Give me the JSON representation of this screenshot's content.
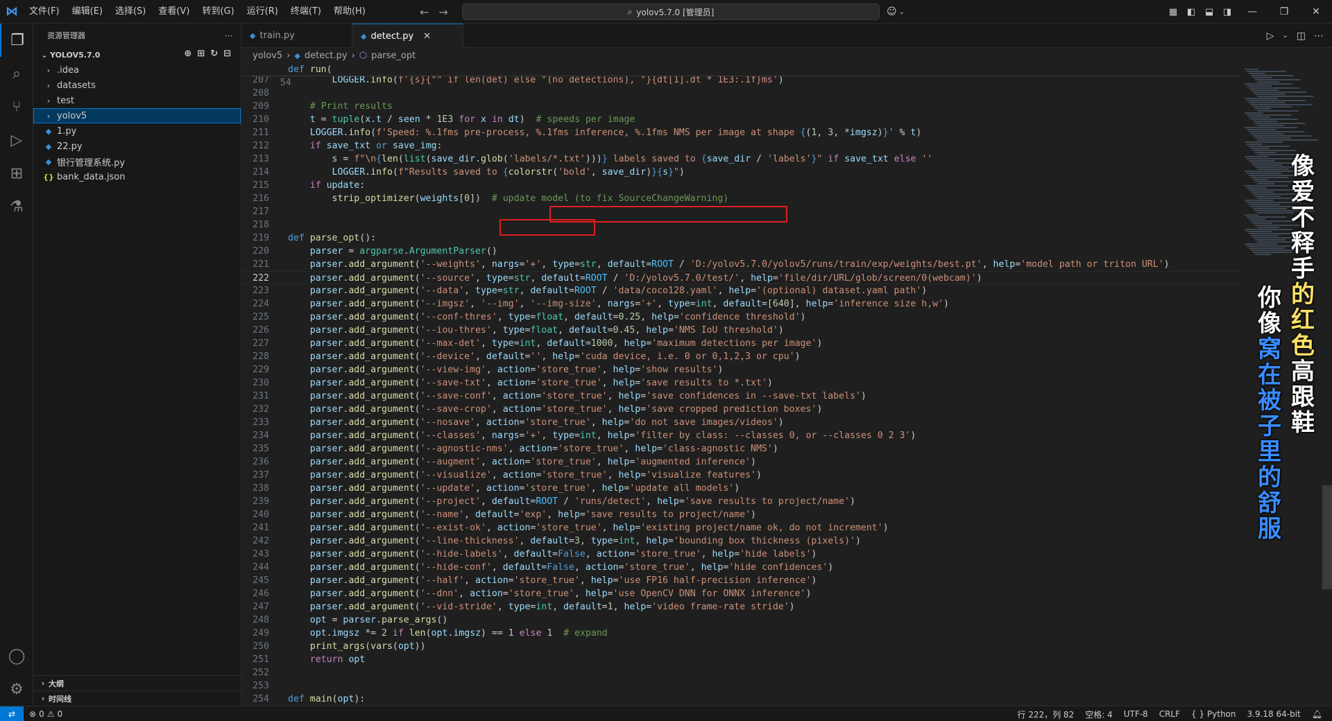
{
  "menu": [
    "文件(F)",
    "编辑(E)",
    "选择(S)",
    "查看(V)",
    "转到(G)",
    "运行(R)",
    "终端(T)",
    "帮助(H)"
  ],
  "command_center": "yolov5.7.0 [管理员]",
  "sidebar": {
    "title": "资源管理器",
    "root": "YOLOV5.7.0",
    "items": [
      {
        "label": ".idea",
        "type": "folder"
      },
      {
        "label": "datasets",
        "type": "folder"
      },
      {
        "label": "test",
        "type": "folder"
      },
      {
        "label": "yolov5",
        "type": "folder",
        "selected": true
      },
      {
        "label": "1.py",
        "type": "py"
      },
      {
        "label": "22.py",
        "type": "py"
      },
      {
        "label": "银行管理系统.py",
        "type": "py"
      },
      {
        "label": "bank_data.json",
        "type": "json"
      }
    ],
    "outline": "大纲",
    "timeline": "时间线"
  },
  "tabs": [
    {
      "label": "train.py",
      "active": false
    },
    {
      "label": "detect.py",
      "active": true
    }
  ],
  "breadcrumb": [
    "yolov5",
    "detect.py",
    "parse_opt"
  ],
  "sticky": {
    "ln": "54",
    "text": "def run("
  },
  "lines": [
    {
      "ln": "207",
      "html": "        <span class='var'>LOGGER</span>.<span class='fn'>info</span>(<span class='str'>f'{s}{\"\" if len(det) else \"(no detections), \"}{dt[1].dt * 1E3:.1f}ms'</span>)"
    },
    {
      "ln": "208",
      "html": ""
    },
    {
      "ln": "209",
      "html": "    <span class='cmt'># Print results</span>"
    },
    {
      "ln": "210",
      "html": "    <span class='var'>t</span> = <span class='cls'>tuple</span>(<span class='var'>x</span>.<span class='var'>t</span> / <span class='var'>seen</span> * <span class='num'>1E3</span> <span class='kc'>for</span> <span class='var'>x</span> <span class='kc'>in</span> <span class='var'>dt</span>)  <span class='cmt'># speeds per image</span>"
    },
    {
      "ln": "211",
      "html": "    <span class='var'>LOGGER</span>.<span class='fn'>info</span>(<span class='str'>f'Speed: %.1fms pre-process, %.1fms inference, %.1fms NMS per image at shape </span><span class='kw'>{</span>(<span class='num'>1</span>, <span class='num'>3</span>, *<span class='var'>imgsz</span>)<span class='kw'>}</span><span class='str'>'</span> % <span class='var'>t</span>)"
    },
    {
      "ln": "212",
      "html": "    <span class='kc'>if</span> <span class='var'>save_txt</span> <span class='kw'>or</span> <span class='var'>save_img</span>:"
    },
    {
      "ln": "213",
      "html": "        <span class='var'>s</span> = <span class='str'>f\"\\n</span><span class='kw'>{</span><span class='fn'>len</span>(<span class='cls'>list</span>(<span class='var'>save_dir</span>.<span class='fn'>glob</span>(<span class='str'>'labels/*.txt'</span>)))<span class='kw'>}</span><span class='str'> labels saved to </span><span class='kw'>{</span><span class='var'>save_dir</span> / <span class='str'>'labels'</span><span class='kw'>}</span><span class='str'>\"</span> <span class='kc'>if</span> <span class='var'>save_txt</span> <span class='kc'>else</span> <span class='str'>''</span>"
    },
    {
      "ln": "214",
      "html": "        <span class='var'>LOGGER</span>.<span class='fn'>info</span>(<span class='str'>f\"Results saved to </span><span class='kw'>{</span><span class='fn'>colorstr</span>(<span class='str'>'bold'</span>, <span class='var'>save_dir</span>)<span class='kw'>}</span><span class='kw'>{</span><span class='var'>s</span><span class='kw'>}</span><span class='str'>\"</span>)"
    },
    {
      "ln": "215",
      "html": "    <span class='kc'>if</span> <span class='var'>update</span>:"
    },
    {
      "ln": "216",
      "html": "        <span class='fn'>strip_optimizer</span>(<span class='var'>weights</span>[<span class='num'>0</span>])  <span class='cmt'># update model (to fix SourceChangeWarning)</span>"
    },
    {
      "ln": "217",
      "html": ""
    },
    {
      "ln": "218",
      "html": ""
    },
    {
      "ln": "219",
      "html": "<span class='kw'>def</span> <span class='fn'>parse_opt</span>():"
    },
    {
      "ln": "220",
      "html": "    <span class='var'>parser</span> = <span class='cls'>argparse</span>.<span class='cls'>ArgumentParser</span>()"
    },
    {
      "ln": "221",
      "html": "    <span class='var'>parser</span>.<span class='fn'>add_argument</span>(<span class='str'>'--weights'</span>, <span class='var'>nargs</span>=<span class='str'>'+'</span>, <span class='var'>type</span>=<span class='cls'>str</span>, <span class='var'>default</span>=<span class='const'>ROOT</span> / <span class='str'>'D:/yolov5.7.0/yolov5/runs/train/exp/weights/best.pt'</span>, <span class='var'>help</span>=<span class='str'>'model path or triton URL'</span>)"
    },
    {
      "ln": "222",
      "cur": true,
      "html": "    <span class='var'>parser</span>.<span class='fn'>add_argument</span>(<span class='str'>'--source'</span>, <span class='var'>type</span>=<span class='cls'>str</span>, <span class='var'>default</span>=<span class='const'>ROOT</span> / <span class='str'>'D:/yolov5.7.0/test/'</span>, <span class='var'>help</span>=<span class='str'>'file/dir/URL/glob/screen/0(webcam)'</span>)"
    },
    {
      "ln": "223",
      "html": "    <span class='var'>parser</span>.<span class='fn'>add_argument</span>(<span class='str'>'--data'</span>, <span class='var'>type</span>=<span class='cls'>str</span>, <span class='var'>default</span>=<span class='const'>ROOT</span> / <span class='str'>'data/coco128.yaml'</span>, <span class='var'>help</span>=<span class='str'>'(optional) dataset.yaml path'</span>)"
    },
    {
      "ln": "224",
      "html": "    <span class='var'>parser</span>.<span class='fn'>add_argument</span>(<span class='str'>'--imgsz'</span>, <span class='str'>'--img'</span>, <span class='str'>'--img-size'</span>, <span class='var'>nargs</span>=<span class='str'>'+'</span>, <span class='var'>type</span>=<span class='cls'>int</span>, <span class='var'>default</span>=[<span class='num'>640</span>], <span class='var'>help</span>=<span class='str'>'inference size h,w'</span>)"
    },
    {
      "ln": "225",
      "html": "    <span class='var'>parser</span>.<span class='fn'>add_argument</span>(<span class='str'>'--conf-thres'</span>, <span class='var'>type</span>=<span class='cls'>float</span>, <span class='var'>default</span>=<span class='num'>0.25</span>, <span class='var'>help</span>=<span class='str'>'confidence threshold'</span>)"
    },
    {
      "ln": "226",
      "html": "    <span class='var'>parser</span>.<span class='fn'>add_argument</span>(<span class='str'>'--iou-thres'</span>, <span class='var'>type</span>=<span class='cls'>float</span>, <span class='var'>default</span>=<span class='num'>0.45</span>, <span class='var'>help</span>=<span class='str'>'NMS IoU threshold'</span>)"
    },
    {
      "ln": "227",
      "html": "    <span class='var'>parser</span>.<span class='fn'>add_argument</span>(<span class='str'>'--max-det'</span>, <span class='var'>type</span>=<span class='cls'>int</span>, <span class='var'>default</span>=<span class='num'>1000</span>, <span class='var'>help</span>=<span class='str'>'maximum detections per image'</span>)"
    },
    {
      "ln": "228",
      "html": "    <span class='var'>parser</span>.<span class='fn'>add_argument</span>(<span class='str'>'--device'</span>, <span class='var'>default</span>=<span class='str'>''</span>, <span class='var'>help</span>=<span class='str'>'cuda device, i.e. 0 or 0,1,2,3 or cpu'</span>)"
    },
    {
      "ln": "229",
      "html": "    <span class='var'>parser</span>.<span class='fn'>add_argument</span>(<span class='str'>'--view-img'</span>, <span class='var'>action</span>=<span class='str'>'store_true'</span>, <span class='var'>help</span>=<span class='str'>'show results'</span>)"
    },
    {
      "ln": "230",
      "html": "    <span class='var'>parser</span>.<span class='fn'>add_argument</span>(<span class='str'>'--save-txt'</span>, <span class='var'>action</span>=<span class='str'>'store_true'</span>, <span class='var'>help</span>=<span class='str'>'save results to *.txt'</span>)"
    },
    {
      "ln": "231",
      "html": "    <span class='var'>parser</span>.<span class='fn'>add_argument</span>(<span class='str'>'--save-conf'</span>, <span class='var'>action</span>=<span class='str'>'store_true'</span>, <span class='var'>help</span>=<span class='str'>'save confidences in --save-txt labels'</span>)"
    },
    {
      "ln": "232",
      "html": "    <span class='var'>parser</span>.<span class='fn'>add_argument</span>(<span class='str'>'--save-crop'</span>, <span class='var'>action</span>=<span class='str'>'store_true'</span>, <span class='var'>help</span>=<span class='str'>'save cropped prediction boxes'</span>)"
    },
    {
      "ln": "233",
      "html": "    <span class='var'>parser</span>.<span class='fn'>add_argument</span>(<span class='str'>'--nosave'</span>, <span class='var'>action</span>=<span class='str'>'store_true'</span>, <span class='var'>help</span>=<span class='str'>'do not save images/videos'</span>)"
    },
    {
      "ln": "234",
      "html": "    <span class='var'>parser</span>.<span class='fn'>add_argument</span>(<span class='str'>'--classes'</span>, <span class='var'>nargs</span>=<span class='str'>'+'</span>, <span class='var'>type</span>=<span class='cls'>int</span>, <span class='var'>help</span>=<span class='str'>'filter by class: --classes 0, or --classes 0 2 3'</span>)"
    },
    {
      "ln": "235",
      "html": "    <span class='var'>parser</span>.<span class='fn'>add_argument</span>(<span class='str'>'--agnostic-nms'</span>, <span class='var'>action</span>=<span class='str'>'store_true'</span>, <span class='var'>help</span>=<span class='str'>'class-agnostic NMS'</span>)"
    },
    {
      "ln": "236",
      "html": "    <span class='var'>parser</span>.<span class='fn'>add_argument</span>(<span class='str'>'--augment'</span>, <span class='var'>action</span>=<span class='str'>'store_true'</span>, <span class='var'>help</span>=<span class='str'>'augmented inference'</span>)"
    },
    {
      "ln": "237",
      "html": "    <span class='var'>parser</span>.<span class='fn'>add_argument</span>(<span class='str'>'--visualize'</span>, <span class='var'>action</span>=<span class='str'>'store_true'</span>, <span class='var'>help</span>=<span class='str'>'visualize features'</span>)"
    },
    {
      "ln": "238",
      "html": "    <span class='var'>parser</span>.<span class='fn'>add_argument</span>(<span class='str'>'--update'</span>, <span class='var'>action</span>=<span class='str'>'store_true'</span>, <span class='var'>help</span>=<span class='str'>'update all models'</span>)"
    },
    {
      "ln": "239",
      "html": "    <span class='var'>parser</span>.<span class='fn'>add_argument</span>(<span class='str'>'--project'</span>, <span class='var'>default</span>=<span class='const'>ROOT</span> / <span class='str'>'runs/detect'</span>, <span class='var'>help</span>=<span class='str'>'save results to project/name'</span>)"
    },
    {
      "ln": "240",
      "html": "    <span class='var'>parser</span>.<span class='fn'>add_argument</span>(<span class='str'>'--name'</span>, <span class='var'>default</span>=<span class='str'>'exp'</span>, <span class='var'>help</span>=<span class='str'>'save results to project/name'</span>)"
    },
    {
      "ln": "241",
      "html": "    <span class='var'>parser</span>.<span class='fn'>add_argument</span>(<span class='str'>'--exist-ok'</span>, <span class='var'>action</span>=<span class='str'>'store_true'</span>, <span class='var'>help</span>=<span class='str'>'existing project/name ok, do not increment'</span>)"
    },
    {
      "ln": "242",
      "html": "    <span class='var'>parser</span>.<span class='fn'>add_argument</span>(<span class='str'>'--line-thickness'</span>, <span class='var'>default</span>=<span class='num'>3</span>, <span class='var'>type</span>=<span class='cls'>int</span>, <span class='var'>help</span>=<span class='str'>'bounding box thickness (pixels)'</span>)"
    },
    {
      "ln": "243",
      "html": "    <span class='var'>parser</span>.<span class='fn'>add_argument</span>(<span class='str'>'--hide-labels'</span>, <span class='var'>default</span>=<span class='kw'>False</span>, <span class='var'>action</span>=<span class='str'>'store_true'</span>, <span class='var'>help</span>=<span class='str'>'hide labels'</span>)"
    },
    {
      "ln": "244",
      "html": "    <span class='var'>parser</span>.<span class='fn'>add_argument</span>(<span class='str'>'--hide-conf'</span>, <span class='var'>default</span>=<span class='kw'>False</span>, <span class='var'>action</span>=<span class='str'>'store_true'</span>, <span class='var'>help</span>=<span class='str'>'hide confidences'</span>)"
    },
    {
      "ln": "245",
      "html": "    <span class='var'>parser</span>.<span class='fn'>add_argument</span>(<span class='str'>'--half'</span>, <span class='var'>action</span>=<span class='str'>'store_true'</span>, <span class='var'>help</span>=<span class='str'>'use FP16 half-precision inference'</span>)"
    },
    {
      "ln": "246",
      "html": "    <span class='var'>parser</span>.<span class='fn'>add_argument</span>(<span class='str'>'--dnn'</span>, <span class='var'>action</span>=<span class='str'>'store_true'</span>, <span class='var'>help</span>=<span class='str'>'use OpenCV DNN for ONNX inference'</span>)"
    },
    {
      "ln": "247",
      "html": "    <span class='var'>parser</span>.<span class='fn'>add_argument</span>(<span class='str'>'--vid-stride'</span>, <span class='var'>type</span>=<span class='cls'>int</span>, <span class='var'>default</span>=<span class='num'>1</span>, <span class='var'>help</span>=<span class='str'>'video frame-rate stride'</span>)"
    },
    {
      "ln": "248",
      "html": "    <span class='var'>opt</span> = <span class='var'>parser</span>.<span class='fn'>parse_args</span>()"
    },
    {
      "ln": "249",
      "html": "    <span class='var'>opt</span>.<span class='var'>imgsz</span> *= <span class='num'>2</span> <span class='kc'>if</span> <span class='fn'>len</span>(<span class='var'>opt</span>.<span class='var'>imgsz</span>) == <span class='num'>1</span> <span class='kc'>else</span> <span class='num'>1</span>  <span class='cmt'># expand</span>"
    },
    {
      "ln": "250",
      "html": "    <span class='fn'>print_args</span>(<span class='fn'>vars</span>(<span class='var'>opt</span>))"
    },
    {
      "ln": "251",
      "html": "    <span class='kc'>return</span> <span class='var'>opt</span>"
    },
    {
      "ln": "252",
      "html": ""
    },
    {
      "ln": "253",
      "html": ""
    },
    {
      "ln": "254",
      "html": "<span class='kw'>def</span> <span class='fn'>main</span>(<span class='var'>opt</span>):"
    }
  ],
  "overlay_caption": {
    "right_column": "像爱不释手的红色高跟鞋",
    "left_column": "你像窝在被子里的舒服",
    "colors": {
      "yellow": "#ffe066",
      "red": "#ff3030",
      "white": "#ffffff",
      "blue": "#3a8cff"
    }
  },
  "status": {
    "errors": "0",
    "warnings": "0",
    "position": "行 222，列 82",
    "spaces": "空格: 4",
    "encoding": "UTF-8",
    "eol": "CRLF",
    "language": "Python",
    "interpreter": "3.9.18 64-bit"
  },
  "colors": {
    "accent": "#0078d4",
    "editor_bg": "#1f1f1f",
    "annotation_box": "#e02020"
  }
}
